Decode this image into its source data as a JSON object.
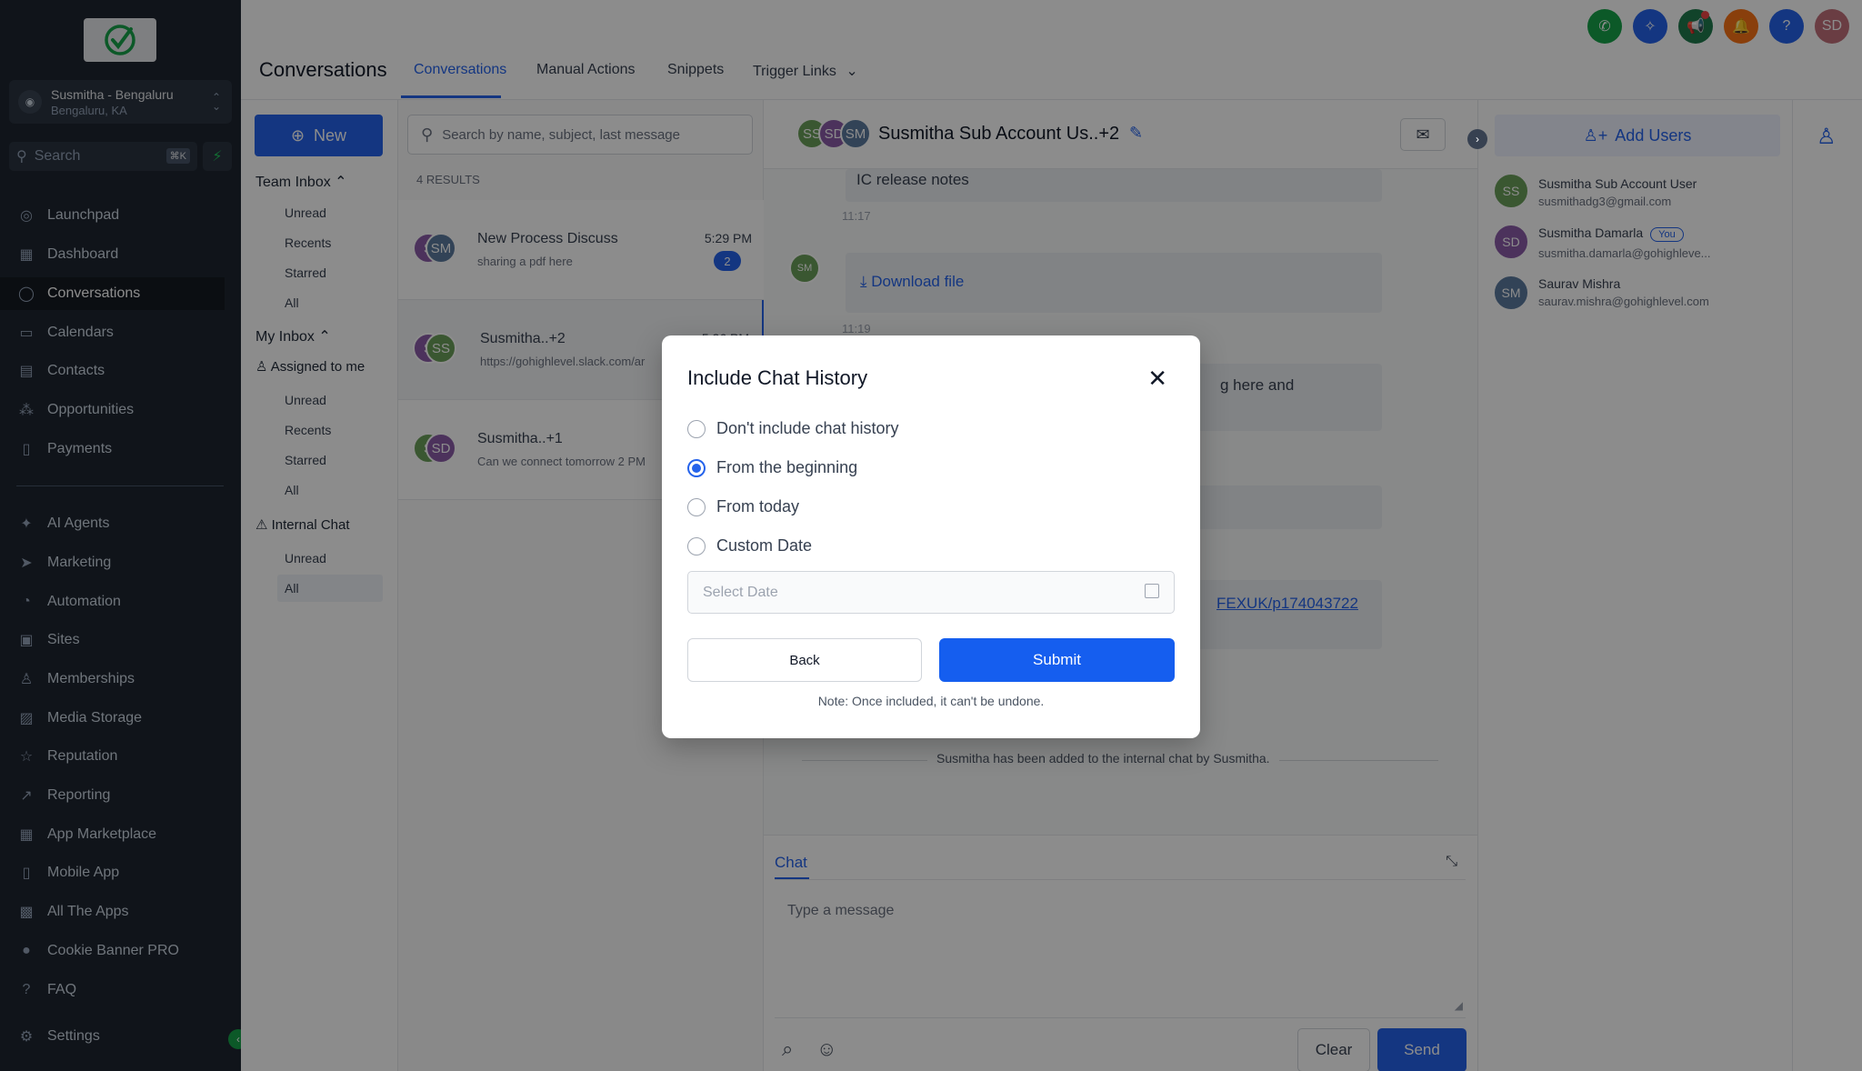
{
  "sidebar": {
    "account_name": "Susmitha - Bengaluru",
    "account_location": "Bengaluru, KA",
    "search_placeholder": "Search",
    "search_shortcut": "⌘K",
    "items": [
      {
        "label": "Launchpad",
        "icon": "rocket-icon"
      },
      {
        "label": "Dashboard",
        "icon": "grid-icon"
      },
      {
        "label": "Conversations",
        "icon": "chat-icon"
      },
      {
        "label": "Calendars",
        "icon": "calendar-icon"
      },
      {
        "label": "Contacts",
        "icon": "contacts-icon"
      },
      {
        "label": "Opportunities",
        "icon": "opportunities-icon"
      },
      {
        "label": "Payments",
        "icon": "payments-icon"
      },
      {
        "label": "AI Agents",
        "icon": "sparkle-icon"
      },
      {
        "label": "Marketing",
        "icon": "send-icon"
      },
      {
        "label": "Automation",
        "icon": "automation-icon"
      },
      {
        "label": "Sites",
        "icon": "sites-icon"
      },
      {
        "label": "Memberships",
        "icon": "membership-icon"
      },
      {
        "label": "Media Storage",
        "icon": "image-icon"
      },
      {
        "label": "Reputation",
        "icon": "star-icon"
      },
      {
        "label": "Reporting",
        "icon": "chart-icon"
      },
      {
        "label": "App Marketplace",
        "icon": "apps-icon"
      },
      {
        "label": "Mobile App",
        "icon": "phone-icon"
      },
      {
        "label": "All The Apps",
        "icon": "all-apps-icon"
      },
      {
        "label": "Cookie Banner PRO",
        "icon": "cookie-icon"
      },
      {
        "label": "FAQ",
        "icon": "question-icon"
      },
      {
        "label": "Settings",
        "icon": "gear-icon"
      }
    ]
  },
  "topbar": {
    "title": "Conversations",
    "tabs": [
      "Conversations",
      "Manual Actions",
      "Snippets",
      "Trigger Links"
    ],
    "user_initials": "SD",
    "help_label": "?"
  },
  "inbox": {
    "new_label": "New",
    "team_inbox": "Team Inbox",
    "team_items": [
      "Unread",
      "Recents",
      "Starred",
      "All"
    ],
    "my_inbox": "My Inbox",
    "assigned": "Assigned to me",
    "my_items": [
      "Unread",
      "Recents",
      "Starred",
      "All"
    ],
    "internal_chat": "Internal Chat",
    "internal_items": [
      "Unread",
      "All"
    ]
  },
  "list": {
    "search_placeholder": "Search by name, subject, last message",
    "results": "4 RESULTS",
    "conversations": [
      {
        "title": "New Process Discuss",
        "subtitle": "sharing a pdf here",
        "time": "5:29 PM",
        "badge": "2",
        "avatars": [
          "S",
          "SM"
        ]
      },
      {
        "title": "Susmitha..+2",
        "subtitle": "https://gohighlevel.slack.com/ar",
        "time": "5:26 PM",
        "avatars": [
          "S",
          "SS"
        ]
      },
      {
        "title": "Susmitha..+1",
        "subtitle": "Can we connect tomorrow 2 PM",
        "time": "",
        "avatars": [
          "S",
          "SD"
        ]
      }
    ]
  },
  "chat": {
    "avatars": [
      "SS",
      "SD",
      "SM"
    ],
    "title": "Susmitha Sub Account Us..+2",
    "msg1": "IC release notes",
    "ts1": "11:17",
    "sender_initials": "SM",
    "download": "Download file",
    "ts2": "11:19",
    "msg3_fragment": "g here and",
    "link_fragment": "FEXUK/p174043722",
    "system_msg": "Susmitha has been added to the internal chat by Susmitha.",
    "compose_tab": "Chat",
    "placeholder": "Type a message",
    "clear": "Clear",
    "send": "Send"
  },
  "right": {
    "add_users": "Add Users",
    "you_badge": "You",
    "users": [
      {
        "initials": "SS",
        "name": "Susmitha Sub Account User",
        "email": "susmithadg3@gmail.com",
        "color": "#6b9e5a"
      },
      {
        "initials": "SD",
        "name": "Susmitha Damarla",
        "email": "susmitha.damarla@gohighleve...",
        "color": "#8b5ca8"
      },
      {
        "initials": "SM",
        "name": "Saurav Mishra",
        "email": "saurav.mishra@gohighlevel.com",
        "color": "#5b7a9e"
      }
    ]
  },
  "modal": {
    "title": "Include Chat History",
    "options": [
      "Don't include chat history",
      "From the beginning",
      "From today",
      "Custom Date"
    ],
    "selected_index": 1,
    "date_placeholder": "Select Date",
    "back": "Back",
    "submit": "Submit",
    "note": "Note: Once included, it can't be undone."
  },
  "colors": {
    "accent": "#2563eb",
    "sidebar_bg": "#1e2530",
    "green": "#16a34a"
  }
}
